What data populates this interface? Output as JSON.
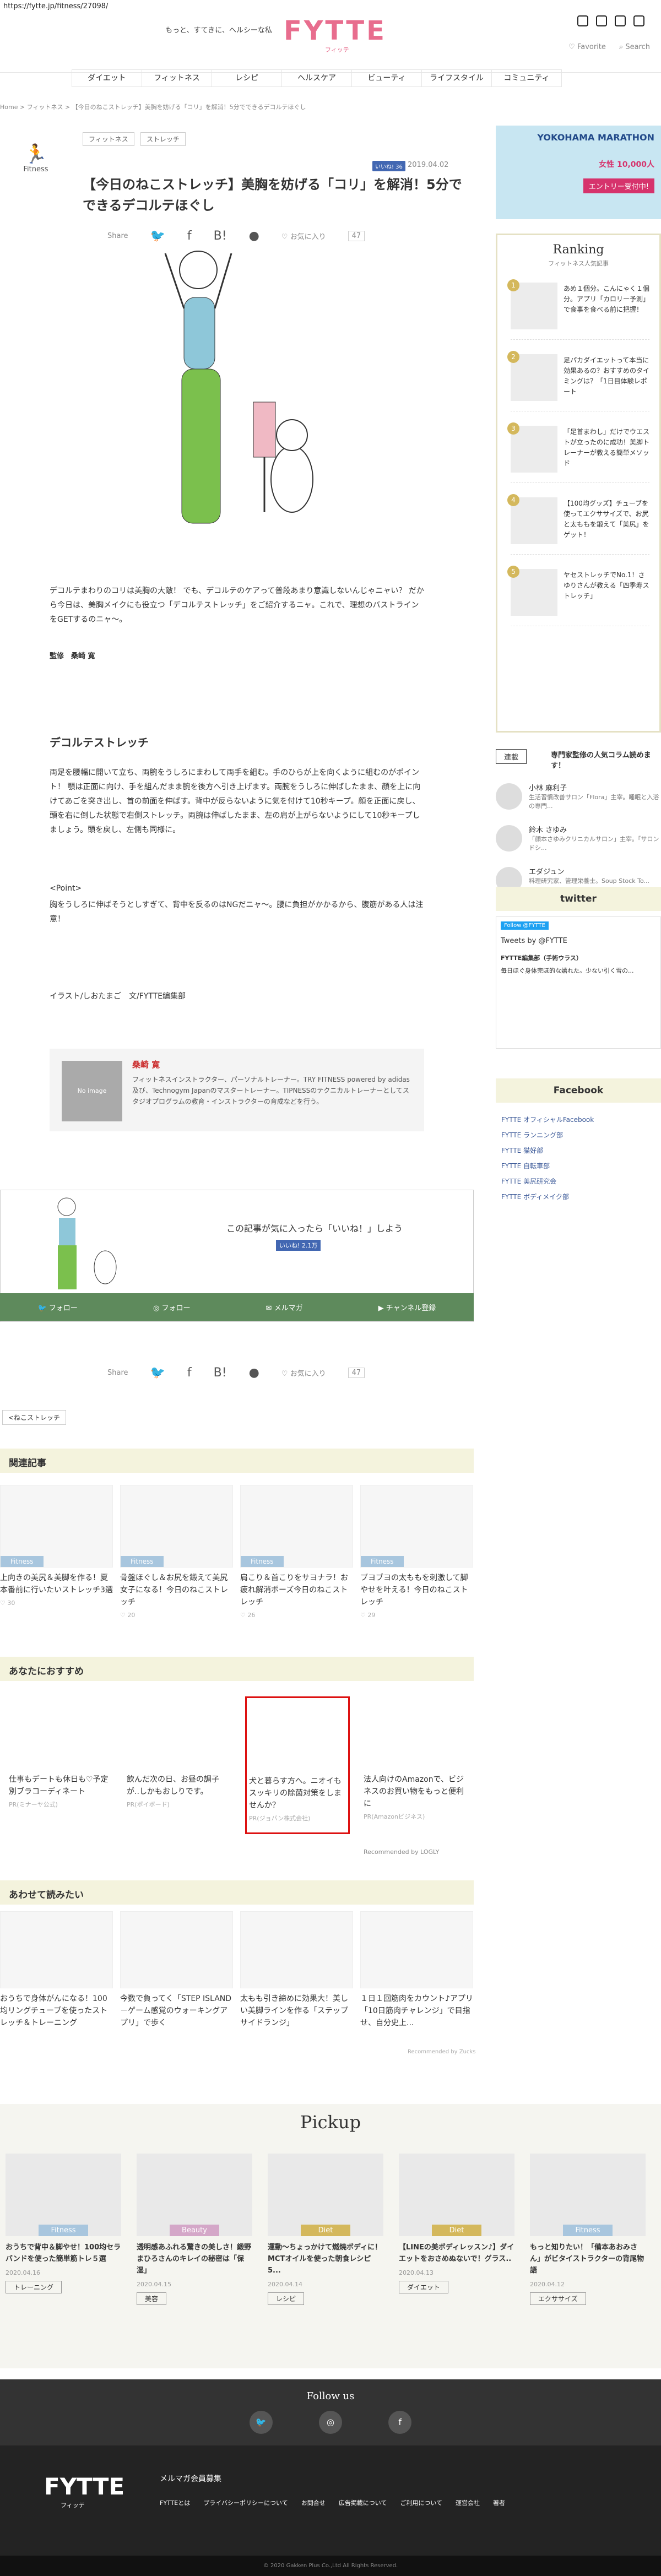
{
  "url": "https://fytte.jp/fitness/27098/",
  "header": {
    "tagline": "もっと、すてきに、ヘルシーな私",
    "logo": "FYTTE",
    "logo_sub": "フィッテ",
    "favorite": "Favorite",
    "search": "Search"
  },
  "nav": [
    "ダイエット",
    "フィットネス",
    "レシピ",
    "ヘルスケア",
    "ビューティ",
    "ライフスタイル",
    "コミュニティ"
  ],
  "breadcrumb": "Home > フィットネス > 【今日のねこストレッチ】美胸を妨げる「コリ」を解消！5分でできるデコルテほぐし",
  "article": {
    "category": "Fitness",
    "pills": [
      "フィットネス",
      "ストレッチ"
    ],
    "like": "いいね! 36",
    "date": "2019.04.02",
    "title": "【今日のねこストレッチ】美胸を妨げる「コリ」を解消！5分でできるデコルテほぐし",
    "share_label": "Share",
    "fav": "お気に入り",
    "count": "47",
    "intro": "デコルテまわりのコリは美胸の大敵！ でも、デコルテのケアって普段あまり意識しないんじゃニャい？ だから今日は、美胸メイクにも役立つ「デコルテストレッチ」をご紹介するニャ。これで、理想のバストラインをGETするのニャ～。",
    "supervisor_label": "監修",
    "supervisor": "桑崎 寛",
    "h2": "デコルテストレッチ",
    "body": "両足を腰幅に開いて立ち、両腕をうしろにまわして両手を組む。手のひらが上を向くように組むのがポイント！ 顎は正面に向け、手を組んだまま腕を後方へ引き上げます。両腕をうしろに伸ばしたまま、顔を上に向けてあごを突き出し、首の前面を伸ばす。背中が反らないように気を付けて10秒キープ。顔を正面に戻し、頭を右に倒した状態で右側ストレッチ。両腕は伸ばしたまま、左の肩が上がらないようにして10秒キープしましょう。頭を戻し、左側も同様に。",
    "point_label": "<Point>",
    "point": "胸をうしろに伸ばそうとしすぎて、背中を反るのはNGだニャ～。腰に負担がかかるから、腹筋がある人は注意！",
    "credit": "イラスト/しおたまご　文/FYTTE編集部",
    "author_noimg": "No image",
    "author_name": "桑崎 寛",
    "author_bio": "フィットネスインストラクター、パーソナルトレーナー。TRY FITNESS powered by adidas及び、Technogym Japanのマスタートレーナー。TIPNESSのテクニカルトレーナーとしてスタジオプログラムの教育・インストラクターの育成などを行う。",
    "banner_text": "この記事が気に入ったら「いいね！」しよう",
    "banner_like": "いいね! 2.1万",
    "follow": [
      "フォロー",
      "フォロー",
      "メルマガ",
      "チャンネル登録"
    ],
    "back": "<ねこストレッチ"
  },
  "related": {
    "title": "関連記事",
    "items": [
      {
        "label": "Fitness",
        "t": "上向きの美尻＆美脚を作る！夏本番前に行いたいストレッチ3選",
        "m": "♡ 30"
      },
      {
        "label": "Fitness",
        "t": "骨盤ほぐし＆お尻を鍛えて美尻女子になる！今日のねこストレッチ",
        "m": "♡ 20"
      },
      {
        "label": "Fitness",
        "t": "肩こり＆首こりをサヨナラ！お疲れ解消ポーズ今日のねこストレッチ",
        "m": "♡ 26"
      },
      {
        "label": "Fitness",
        "t": "ブヨブヨの太ももを刺激して脚やせを叶える！今日のねこストレッチ",
        "m": "♡ 29"
      }
    ]
  },
  "recommend": {
    "title": "あなたにおすすめ",
    "items": [
      {
        "t": "仕事もデートも休日も♡予定別ブラコーディネート",
        "s": "PR(ミナーヤ公式)"
      },
      {
        "t": "飲んだ次の日、お昼の調子が..しかもおしりです。",
        "s": "PR(ポイボード)"
      },
      {
        "t": "犬と暮らす方へ。ニオイもスッキリの除菌対策をしませんか？",
        "s": "PR(ジョバン株式会社)"
      },
      {
        "t": "法人向けのAmazonで、ビジネスのお買い物をもっと便利に",
        "s": "PR(Amazonビジネス)"
      }
    ],
    "powered": "Recommended by LOGLY"
  },
  "also": {
    "title": "あわせて読みたい",
    "items": [
      {
        "t": "おうちで身体がんになる！100均リングチューブを使ったストレッチ＆トレーニング"
      },
      {
        "t": "今数で負ってく「STEP ISLAND－ゲーム感覚のウォーキングアプリ」で歩く"
      },
      {
        "t": "太もも引き締めに効果大！美しい美脚ラインを作る「ステップサイドランジ」"
      },
      {
        "t": "１日１回筋肉をカウント♪アプリ「10日筋肉チャレンジ」で目指せ、自分史上..."
      }
    ],
    "powered": "Recommended by Zucks"
  },
  "sidebar": {
    "ad_title": "YOKOHAMA MARATHON",
    "ad_text": "女性 10,000人",
    "ad_btn": "エントリー受付中!",
    "ranking_title": "Ranking",
    "ranking_sub": "フィットネス人気記事",
    "ranking": [
      {
        "n": "1",
        "t": "あめ１個分。こんにゃく１個分。アプリ「カロリー予測」で食事を食べる前に把握！"
      },
      {
        "n": "2",
        "t": "足パカダイエットって本当に効果あるの？おすすめのタイミングは？「1日目体験レポート"
      },
      {
        "n": "3",
        "t": "「足首まわし」だけでウエストが立ったのに成功！美脚トレーナーが教える簡単メソッド"
      },
      {
        "n": "4",
        "t": "【100均グッズ】チューブを使ってエクササイズで、お尻と太ももを鍛えて「美尻」をゲット！"
      },
      {
        "n": "5",
        "t": "ヤセストレッチでNo.1！さゆりさんが教える「四季寿ストレッチ」"
      }
    ],
    "sup_title": "専門家監修の人気コラム読めます！",
    "sup_badge": "連載",
    "sup": [
      {
        "n": "小林 麻利子",
        "d": "生活習慣改善サロン「Flora」主宰。睡眠と入浴の専門..."
      },
      {
        "n": "鈴木 さゆみ",
        "d": "「顔本さゆみクリニカルサロン」主宰。「サロンドシ..."
      },
      {
        "n": "エダジュン",
        "d": "料理研究家、管理栄養士。Soup Stock To..."
      }
    ],
    "twitter": "twitter",
    "tw_follow": "Follow @FYTTE",
    "tweets": "Tweets by @FYTTE",
    "tw_name": "FYTTE編集部（手術ウラス）",
    "tw_text": "毎日ほぐ身体完ぼ的な嬉れた。少ない引く雪の...",
    "facebook": "Facebook",
    "fb": [
      "FYTTE オフィシャルFacebook",
      "FYTTE ランニング部",
      "FYTTE 猫好部",
      "FYTTE 自転車部",
      "FYTTE 美尻研究会",
      "FYTTE ボディメイク部"
    ]
  },
  "pickup": {
    "title": "Pickup",
    "items": [
      {
        "lb": "Fitness",
        "c": "#a8c6de",
        "t": "おうちで背中＆脚やせ！100均セラバンドを使った簡単筋トレ５選",
        "d": "2020.04.16",
        "b": "トレーニング"
      },
      {
        "lb": "Beauty",
        "c": "#d4a7c8",
        "t": "透明感あふれる驚きの美しさ！鍛野まひろさんのキレイの秘密は「保湿」",
        "d": "2020.04.15",
        "b": "美容"
      },
      {
        "lb": "Diet",
        "c": "#d4b85c",
        "t": "運動～ちょっかけて燃焼ボディに！MCTオイルを使った朝食レシピ5...",
        "d": "2020.04.14",
        "b": "レシピ"
      },
      {
        "lb": "Diet",
        "c": "#d4b85c",
        "t": "【LINEの美ボディレッスン♪】ダイエットをおさめぬないで！グラス..",
        "d": "2020.04.13",
        "b": "ダイエット"
      },
      {
        "lb": "Fitness",
        "c": "#a8c6de",
        "t": "もっと知りたい！「備本あおみさん」がビタイストラクターの背尾物語",
        "d": "2020.04.12",
        "b": "エクササイズ"
      }
    ]
  },
  "footer": {
    "follow": "Follow us",
    "logo": "FYTTE",
    "logo_sub": "フィッテ",
    "mail": "メルマガ会員募集",
    "links": [
      "FYTTEとは",
      "プライバシーポリシーについて",
      "お問合せ",
      "広告掲載について",
      "ご利用について",
      "運営会社",
      "著者"
    ],
    "copy": "© 2020 Gakken Plus Co.,Ltd All Rights Reserved."
  }
}
